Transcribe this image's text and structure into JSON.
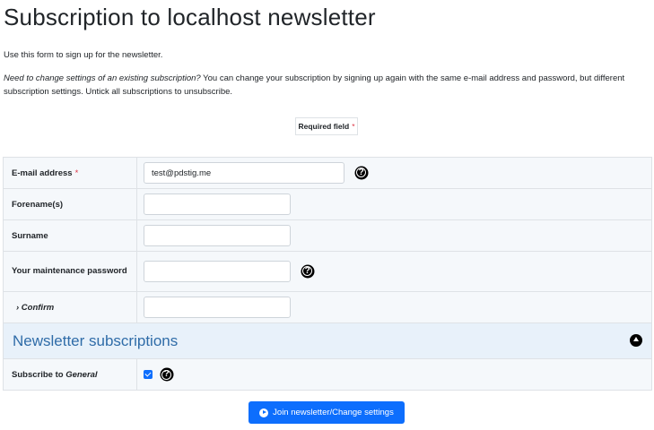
{
  "page": {
    "title": "Subscription to localhost newsletter",
    "intro": "Use this form to sign up for the newsletter.",
    "note_em": "Need to change settings of an existing subscription?",
    "note_rest": " You can change your subscription by signing up again with the same e-mail address and password, but different subscription settings. Untick all subscriptions to unsubscribe.",
    "required_legend": "Required field",
    "required_marker": "*"
  },
  "form": {
    "email_label": "E-mail address",
    "email_value": "test@pdstig.me",
    "forename_label": "Forename(s)",
    "forename_value": "",
    "surname_label": "Surname",
    "surname_value": "",
    "password_label": "Your maintenance password",
    "password_value": "",
    "confirm_label": "› Confirm",
    "confirm_value": "",
    "help_glyph": "?"
  },
  "subscriptions": {
    "heading": "Newsletter subscriptions",
    "subscribe_prefix": "Subscribe to ",
    "list_name": "General",
    "checked": true
  },
  "submit": {
    "label": "Join newsletter/Change settings"
  },
  "icons": {
    "help": "question-circle-icon",
    "toggle": "chevron-up-circle-icon",
    "submit": "play-circle-icon"
  },
  "colors": {
    "accent": "#0d6efd",
    "required": "#dc3545",
    "section_heading": "#2f6ca8"
  }
}
